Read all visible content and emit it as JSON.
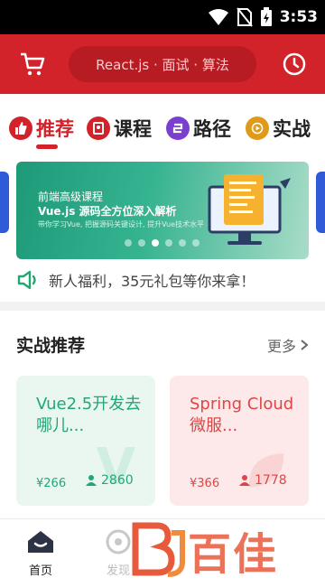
{
  "status_bar": {
    "time": "3:53"
  },
  "header": {
    "search_placeholder": "React.js · 面试 · 算法"
  },
  "tabs": [
    {
      "label": "推荐",
      "icon": "thumb-up-icon",
      "color": "#d2222a",
      "active": true
    },
    {
      "label": "课程",
      "icon": "course-icon",
      "color": "#d2222a",
      "active": false
    },
    {
      "label": "路径",
      "icon": "path-icon",
      "color": "#7b3fd0",
      "active": false
    },
    {
      "label": "实战",
      "icon": "play-icon",
      "color": "#e09a1a",
      "active": false
    }
  ],
  "banner": {
    "line1": "前端高级课程",
    "line2": "Vue.js 源码全方位深入解析",
    "line3": "带你学习Vue, 把握源码关键设计, 提升Vue技术水平",
    "dot_count": 6,
    "active_dot": 2
  },
  "notice": {
    "text": "新人福利，35元礼包等你来拿！"
  },
  "recommend": {
    "title": "实战推荐",
    "more_label": "更多",
    "cards": [
      {
        "title": "Vue2.5开发去哪儿...",
        "price": "¥266",
        "students": "2860",
        "theme": "green"
      },
      {
        "title": "Spring Cloud微服...",
        "price": "¥366",
        "students": "1778",
        "theme": "red"
      }
    ]
  },
  "bottom_nav": [
    {
      "label": "首页",
      "icon": "home-icon",
      "active": true
    },
    {
      "label": "发现",
      "icon": "discover-icon",
      "active": false
    }
  ],
  "watermark": {
    "text": "百佳"
  },
  "colors": {
    "brand_red": "#d2222a",
    "green": "#20a872",
    "red_text": "#e04545"
  }
}
